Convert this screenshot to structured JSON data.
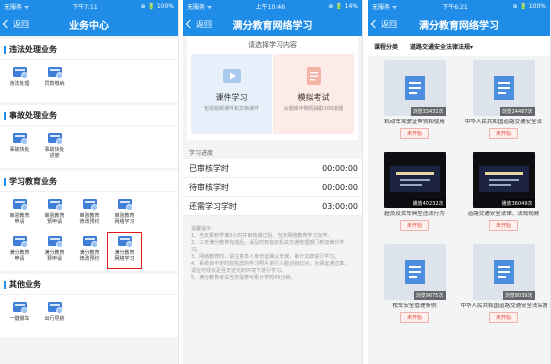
{
  "p1": {
    "status": {
      "carrier": "无服务 ᯤ",
      "time": "下午7:11",
      "battery": "⊕ 🔋 100%"
    },
    "title": "业务中心",
    "back": "返回",
    "sections": [
      {
        "title": "违法处理业务",
        "items": [
          {
            "label": "违法处理",
            "icon": "violation-icon"
          },
          {
            "label": "罚款缴纳",
            "icon": "fine-icon"
          }
        ]
      },
      {
        "title": "事故处理业务",
        "items": [
          {
            "label": "事故快处",
            "icon": "accident-icon"
          },
          {
            "label": "事故快处\n进度",
            "icon": "accident-progress-icon"
          }
        ]
      },
      {
        "title": "学习教育业务",
        "items": [
          {
            "label": "审验教育\n申请",
            "icon": "study-apply-icon"
          },
          {
            "label": "审验教育\n预申请",
            "icon": "study-preapply-icon"
          },
          {
            "label": "审验教育\n修改预约",
            "icon": "study-modify-icon"
          },
          {
            "label": "审验教育\n网络学习",
            "icon": "study-online-icon"
          },
          {
            "label": "满分教育\n申请",
            "icon": "full-apply-icon"
          },
          {
            "label": "满分教育\n预申请",
            "icon": "full-preapply-icon"
          },
          {
            "label": "满分教育\n修改预约",
            "icon": "full-modify-icon"
          },
          {
            "label": "满分教育\n网络学习",
            "icon": "full-online-icon",
            "highlight": true
          }
        ]
      },
      {
        "title": "其他业务",
        "items": [
          {
            "label": "一键挪车",
            "icon": "move-car-icon"
          },
          {
            "label": "出行导航",
            "icon": "navigation-icon"
          }
        ]
      }
    ]
  },
  "p2": {
    "status": {
      "carrier": "无服务 ᯤ",
      "time": "上午10:46",
      "battery": "⊕ 🔋 14%"
    },
    "title": "满分教育网络学习",
    "back": "返回",
    "choose_title": "请选择学习内容",
    "learn": {
      "name": "课件学习",
      "desc": "包括视频课件和文档课件"
    },
    "exam": {
      "name": "模拟考试",
      "desc": "从题库中随机抽取100道题"
    },
    "progress_title": "学习进度",
    "rows": [
      {
        "label": "已审核学时",
        "value": "00:00:00"
      },
      {
        "label": "待审核学时",
        "value": "00:00:00"
      },
      {
        "label": "还需学习学时",
        "value": "03:00:00"
      }
    ],
    "tips": [
      "温馨提示：",
      "1、当天累积学满3小时并审核通过后，当天网络教育学习完毕。",
      "2、三天满分教育完成后，请及时到指定机关交通管理部门参加满分学习。",
      "3、网络教育时，请注意本人身份证确认无误，审计文辞进行学习。",
      "4、系统会不定时抓拍您的学习照片进行人脸识别比对，为保证通过率，请在光线充足且无逆光的环境下进行学习。",
      "5、满分教育考试当天需参可累计学时45分钟。"
    ]
  },
  "p3": {
    "status": {
      "carrier": "无服务 ᯤ",
      "time": "下午6:21",
      "battery": "⊕ 🔋 100%"
    },
    "title": "满分教育网络学习",
    "back": "返回",
    "filter_label": "课程分类",
    "filter_value": "道路交通安全法律法规▾",
    "videos": [
      {
        "views": "浏览33432次",
        "name": "机动车驾驶证申领和使用",
        "state": "未开始",
        "dark": false
      },
      {
        "views": "浏览24487次",
        "name": "中华人民共和国道路交通安全法",
        "state": "未开始",
        "dark": false
      },
      {
        "views": "播放40232次",
        "name": "超员及货车典型违法行为",
        "state": "未开始",
        "dark": true
      },
      {
        "views": "播放36049次",
        "name": "道路交通安全法律、法规视频",
        "state": "未开始",
        "dark": true
      },
      {
        "views": "浏览9675次",
        "name": "校车安全管理条例",
        "state": "未开始",
        "dark": false
      },
      {
        "views": "浏览8039次",
        "name": "中华人民共和国道路交通安全法实施条例",
        "state": "未开始",
        "dark": false
      }
    ]
  }
}
